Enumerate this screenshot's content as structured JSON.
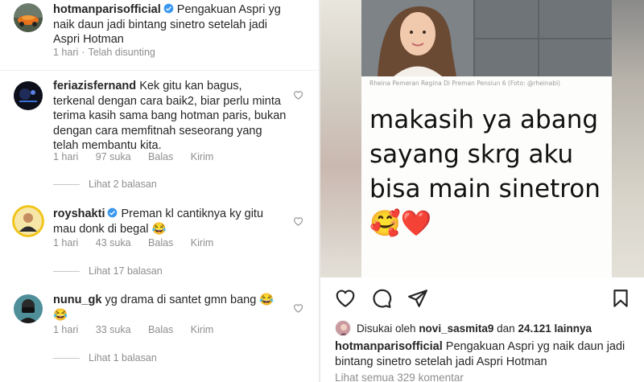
{
  "comments": [
    {
      "username": "hotmanparisofficial",
      "verified": true,
      "text": "Pengakuan Aspri yg naik daun jadi bintang sinetro setelah jadi Aspri Hotman",
      "time": "1 hari",
      "extra": "Telah disunting"
    },
    {
      "username": "feriazisfernand",
      "verified": false,
      "text": "Kek gitu kan bagus, terkenal dengan cara baik2, biar perlu minta terima kasih sama bang hotman paris, bukan dengan cara memfitnah seseorang yang telah membantu kita.",
      "time": "1 hari",
      "likes": "97 suka",
      "reply": "Balas",
      "send": "Kirim",
      "replies": "Lihat 2 balasan"
    },
    {
      "username": "royshakti",
      "verified": true,
      "text": "Preman  kl cantiknya ky gitu mau donk  di  begal 😂",
      "time": "1 hari",
      "likes": "43 suka",
      "reply": "Balas",
      "send": "Kirim",
      "replies": "Lihat 17 balasan"
    },
    {
      "username": "nunu_gk",
      "verified": false,
      "text": "yg drama di santet gmn bang 😂 😂",
      "time": "1 hari",
      "likes": "33 suka",
      "reply": "Balas",
      "send": "Kirim",
      "replies": "Lihat 1 balasan"
    }
  ],
  "post": {
    "card_caption": "Rheina Pemeran Regina Di Preman Pensiun 6 (Foto: @rheinabi)",
    "card_text": "makasih ya abang sayang skrg aku bisa main sinetron🥰❤️",
    "liked_prefix": "Disukai oleh",
    "liked_user": "novi_sasmita9",
    "liked_connector": "dan",
    "liked_count": "24.121 lainnya",
    "caption_user": "hotmanparisofficial",
    "caption_text": "Pengakuan Aspri yg naik daun jadi bintang sinetro setelah jadi Aspri Hotman",
    "view_all": "Lihat semua 329 komentar"
  },
  "icons": {
    "verified": "verified-badge-icon",
    "heart": "heart-icon",
    "comment": "comment-icon",
    "share": "share-icon",
    "save": "bookmark-icon"
  },
  "colors": {
    "verified": "#3897f0",
    "meta_text": "#8e8e8e",
    "heart_red": "#e0245e"
  }
}
